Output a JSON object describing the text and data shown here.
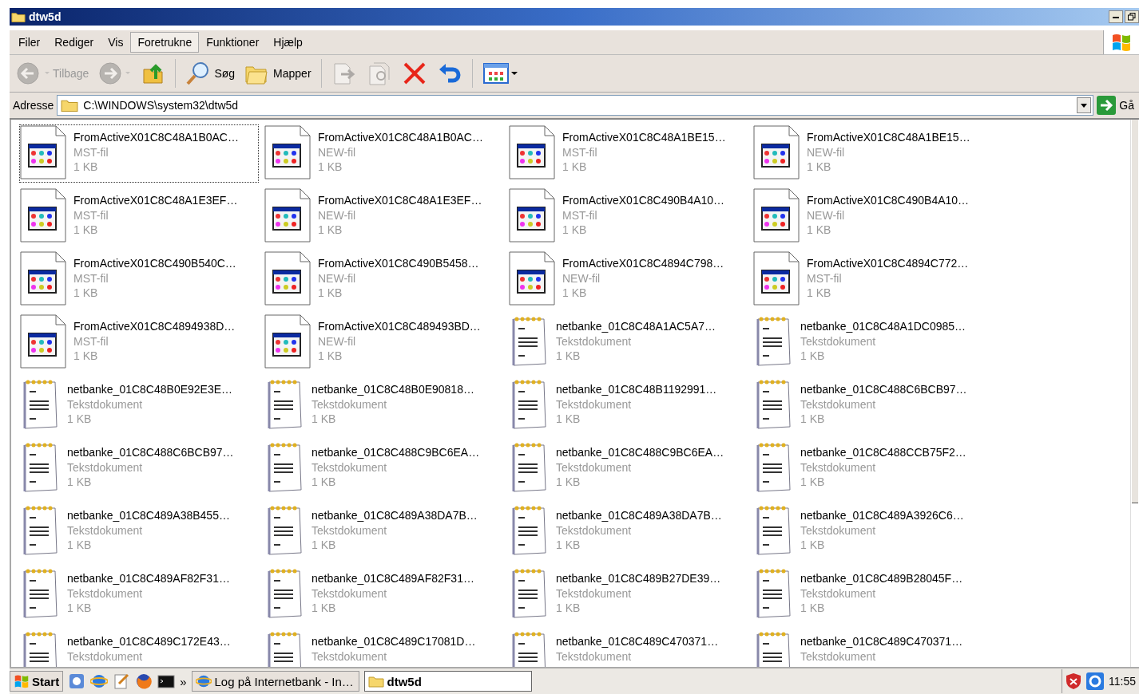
{
  "window": {
    "title": "dtw5d"
  },
  "menu": [
    {
      "label": "Filer",
      "selected": false
    },
    {
      "label": "Rediger",
      "selected": false
    },
    {
      "label": "Vis",
      "selected": false
    },
    {
      "label": "Foretrukne",
      "selected": true
    },
    {
      "label": "Funktioner",
      "selected": false
    },
    {
      "label": "Hjælp",
      "selected": false
    }
  ],
  "toolbar": [
    {
      "kind": "back",
      "label": "Tilbage",
      "disabled": true
    },
    {
      "kind": "forward",
      "disabled": true
    },
    {
      "kind": "up",
      "disabled": false
    },
    {
      "kind": "search",
      "label": "Søg",
      "disabled": false
    },
    {
      "kind": "folders",
      "label": "Mapper",
      "disabled": false
    },
    {
      "kind": "move",
      "disabled": true
    },
    {
      "kind": "copy",
      "disabled": true
    },
    {
      "kind": "delete",
      "disabled": false
    },
    {
      "kind": "undo",
      "disabled": false
    },
    {
      "kind": "views",
      "disabled": false
    }
  ],
  "address": {
    "label": "Adresse",
    "value": "C:\\WINDOWS\\system32\\dtw5d",
    "go": "Gå"
  },
  "files": [
    {
      "kind": "app",
      "name": "FromActiveX01C8C48A1B0AC…",
      "type": "MST-fil",
      "size": "1 KB",
      "selected": true
    },
    {
      "kind": "app",
      "name": "FromActiveX01C8C48A1B0AC…",
      "type": "NEW-fil",
      "size": "1 KB",
      "selected": false
    },
    {
      "kind": "app",
      "name": "FromActiveX01C8C48A1BE15…",
      "type": "MST-fil",
      "size": "1 KB",
      "selected": false
    },
    {
      "kind": "app",
      "name": "FromActiveX01C8C48A1BE15…",
      "type": "NEW-fil",
      "size": "1 KB",
      "selected": false
    },
    {
      "kind": "app",
      "name": "FromActiveX01C8C48A1E3EF…",
      "type": "MST-fil",
      "size": "1 KB",
      "selected": false
    },
    {
      "kind": "app",
      "name": "FromActiveX01C8C48A1E3EF…",
      "type": "NEW-fil",
      "size": "1 KB",
      "selected": false
    },
    {
      "kind": "app",
      "name": "FromActiveX01C8C490B4A10…",
      "type": "MST-fil",
      "size": "1 KB",
      "selected": false
    },
    {
      "kind": "app",
      "name": "FromActiveX01C8C490B4A10…",
      "type": "NEW-fil",
      "size": "1 KB",
      "selected": false
    },
    {
      "kind": "app",
      "name": "FromActiveX01C8C490B540C…",
      "type": "MST-fil",
      "size": "1 KB",
      "selected": false
    },
    {
      "kind": "app",
      "name": "FromActiveX01C8C490B5458…",
      "type": "NEW-fil",
      "size": "1 KB",
      "selected": false
    },
    {
      "kind": "app",
      "name": "FromActiveX01C8C4894C798…",
      "type": "NEW-fil",
      "size": "1 KB",
      "selected": false
    },
    {
      "kind": "app",
      "name": "FromActiveX01C8C4894C772…",
      "type": "MST-fil",
      "size": "1 KB",
      "selected": false
    },
    {
      "kind": "app",
      "name": "FromActiveX01C8C4894938D…",
      "type": "MST-fil",
      "size": "1 KB",
      "selected": false
    },
    {
      "kind": "app",
      "name": "FromActiveX01C8C489493BD…",
      "type": "NEW-fil",
      "size": "1 KB",
      "selected": false
    },
    {
      "kind": "text",
      "name": "netbanke_01C8C48A1AC5A7…",
      "type": "Tekstdokument",
      "size": "1 KB",
      "selected": false
    },
    {
      "kind": "text",
      "name": "netbanke_01C8C48A1DC0985…",
      "type": "Tekstdokument",
      "size": "1 KB",
      "selected": false
    },
    {
      "kind": "text",
      "name": "netbanke_01C8C48B0E92E3E…",
      "type": "Tekstdokument",
      "size": "1 KB",
      "selected": false
    },
    {
      "kind": "text",
      "name": "netbanke_01C8C48B0E90818…",
      "type": "Tekstdokument",
      "size": "1 KB",
      "selected": false
    },
    {
      "kind": "text",
      "name": "netbanke_01C8C48B1192991…",
      "type": "Tekstdokument",
      "size": "1 KB",
      "selected": false
    },
    {
      "kind": "text",
      "name": "netbanke_01C8C488C6BCB97…",
      "type": "Tekstdokument",
      "size": "1 KB",
      "selected": false
    },
    {
      "kind": "text",
      "name": "netbanke_01C8C488C6BCB97…",
      "type": "Tekstdokument",
      "size": "1 KB",
      "selected": false
    },
    {
      "kind": "text",
      "name": "netbanke_01C8C488C9BC6EA…",
      "type": "Tekstdokument",
      "size": "1 KB",
      "selected": false
    },
    {
      "kind": "text",
      "name": "netbanke_01C8C488C9BC6EA…",
      "type": "Tekstdokument",
      "size": "1 KB",
      "selected": false
    },
    {
      "kind": "text",
      "name": "netbanke_01C8C488CCB75F2…",
      "type": "Tekstdokument",
      "size": "1 KB",
      "selected": false
    },
    {
      "kind": "text",
      "name": "netbanke_01C8C489A38B455…",
      "type": "Tekstdokument",
      "size": "1 KB",
      "selected": false
    },
    {
      "kind": "text",
      "name": "netbanke_01C8C489A38DA7B…",
      "type": "Tekstdokument",
      "size": "1 KB",
      "selected": false
    },
    {
      "kind": "text",
      "name": "netbanke_01C8C489A38DA7B…",
      "type": "Tekstdokument",
      "size": "1 KB",
      "selected": false
    },
    {
      "kind": "text",
      "name": "netbanke_01C8C489A3926C6…",
      "type": "Tekstdokument",
      "size": "1 KB",
      "selected": false
    },
    {
      "kind": "text",
      "name": "netbanke_01C8C489AF82F31…",
      "type": "Tekstdokument",
      "size": "1 KB",
      "selected": false
    },
    {
      "kind": "text",
      "name": "netbanke_01C8C489AF82F31…",
      "type": "Tekstdokument",
      "size": "1 KB",
      "selected": false
    },
    {
      "kind": "text",
      "name": "netbanke_01C8C489B27DE39…",
      "type": "Tekstdokument",
      "size": "1 KB",
      "selected": false
    },
    {
      "kind": "text",
      "name": "netbanke_01C8C489B28045F…",
      "type": "Tekstdokument",
      "size": "1 KB",
      "selected": false
    },
    {
      "kind": "text",
      "name": "netbanke_01C8C489C172E43…",
      "type": "Tekstdokument",
      "selected": false
    },
    {
      "kind": "text",
      "name": "netbanke_01C8C489C17081D…",
      "type": "Tekstdokument",
      "selected": false
    },
    {
      "kind": "text",
      "name": "netbanke_01C8C489C470371…",
      "type": "Tekstdokument",
      "selected": false
    },
    {
      "kind": "text",
      "name": "netbanke_01C8C489C470371…",
      "type": "Tekstdokument",
      "selected": false
    }
  ],
  "taskbar": {
    "start": "Start",
    "more": "»",
    "tasks": [
      {
        "label": "Log på Internetbank - In…",
        "selected": false
      },
      {
        "label": "dtw5d",
        "selected": true
      }
    ],
    "clock": "11:55"
  }
}
